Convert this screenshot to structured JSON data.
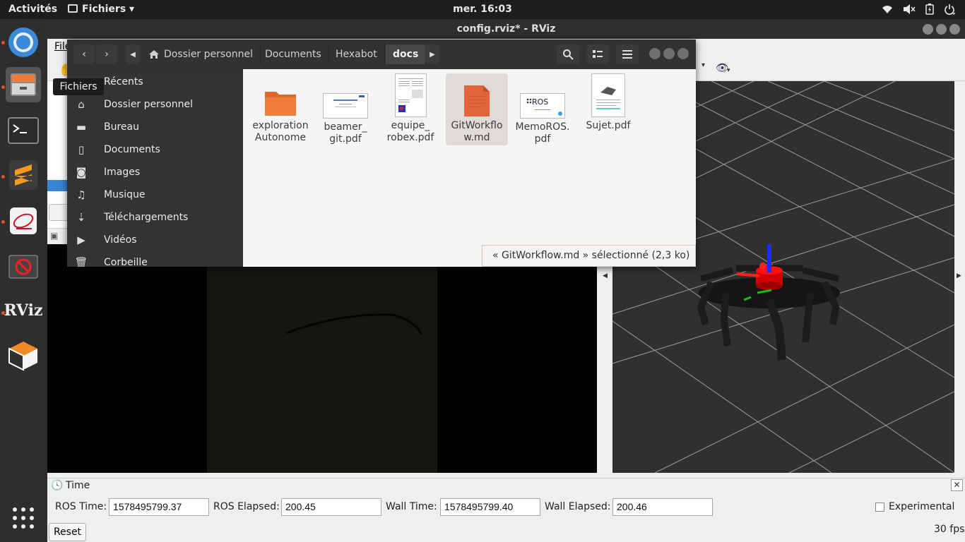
{
  "topbar": {
    "activities": "Activités",
    "app_menu": "Fichiers ▾",
    "clock": "mer. 16:03"
  },
  "dock": {
    "tooltip": "Fichiers",
    "items": [
      "chromium",
      "files",
      "terminal",
      "sublime-text",
      "pdf-reader",
      "blocked-app",
      "rviz",
      "3d-app",
      "show-apps"
    ],
    "rviz_label": "RViz"
  },
  "rviz": {
    "title": "config.rviz* - RViz",
    "menu_file": "File",
    "time_panel": {
      "title": "Time",
      "ros_time_label": "ROS Time:",
      "ros_time": "1578495799.37",
      "ros_elapsed_label": "ROS Elapsed:",
      "ros_elapsed": "200.45",
      "wall_time_label": "Wall Time:",
      "wall_time": "1578495799.40",
      "wall_elapsed_label": "Wall Elapsed:",
      "wall_elapsed": "200.46",
      "experimental_label": "Experimental",
      "reset_label": "Reset",
      "fps": "30 fps"
    }
  },
  "files": {
    "breadcrumbs": [
      "Dossier personnel",
      "Documents",
      "Hexabot",
      "docs"
    ],
    "sidebar": [
      {
        "icon": "clock-icon",
        "label": "Récents"
      },
      {
        "icon": "home-icon",
        "label": "Dossier personnel"
      },
      {
        "icon": "folder-icon",
        "label": "Bureau"
      },
      {
        "icon": "document-icon",
        "label": "Documents"
      },
      {
        "icon": "camera-icon",
        "label": "Images"
      },
      {
        "icon": "music-icon",
        "label": "Musique"
      },
      {
        "icon": "download-icon",
        "label": "Téléchargements"
      },
      {
        "icon": "video-icon",
        "label": "Vidéos"
      },
      {
        "icon": "trash-icon",
        "label": "Corbeille"
      }
    ],
    "items": [
      {
        "line1": "exploration",
        "line2": "Autonome",
        "kind": "folder"
      },
      {
        "line1": "beamer_",
        "line2": "git.pdf",
        "kind": "slide"
      },
      {
        "line1": "equipe_",
        "line2": "robex.pdf",
        "kind": "paper"
      },
      {
        "line1": "GitWorkflo",
        "line2": "w.md",
        "kind": "markdown"
      },
      {
        "line1": "MemoROS.",
        "line2": "pdf",
        "kind": "ros"
      },
      {
        "line1": "Sujet.pdf",
        "line2": "",
        "kind": "paper2"
      }
    ],
    "thumb_texts": {
      "ros": "ROS"
    },
    "status": "« GitWorkflow.md » sélectionné  (2,3 ko)"
  },
  "colors": {
    "accent": "#e95420",
    "folder": "#f07c3a",
    "red_axis": "#e00000",
    "blue_axis": "#0033ff"
  }
}
